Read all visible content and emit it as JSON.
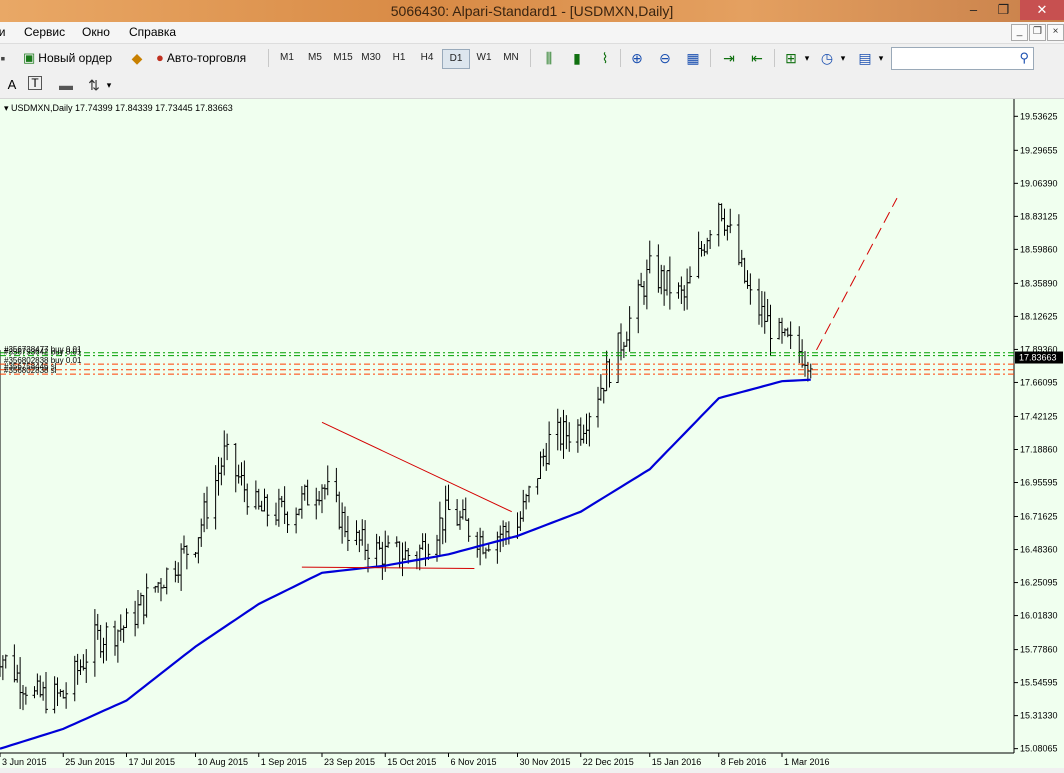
{
  "window": {
    "title": "5066430: Alpari-Standard1 - [USDMXN,Daily]",
    "minimize": "–",
    "restore": "❐",
    "close": "✕"
  },
  "menu": {
    "items": [
      "ии",
      "Сервис",
      "Окно",
      "Справка"
    ]
  },
  "toolbar": {
    "new_order": "Новый ордер",
    "auto_trading": "Авто-торговля",
    "timeframes": [
      "M1",
      "M5",
      "M15",
      "M30",
      "H1",
      "H4",
      "D1",
      "W1",
      "MN"
    ],
    "active_timeframe": "D1",
    "search_placeholder": ""
  },
  "colors": {
    "chart_bg": "#f0ffef",
    "candle": "#000000",
    "ma": "#0000d8",
    "trend": "#d40000",
    "buy_line": "#00a000",
    "sl_line": "#ff3c00",
    "price_tag_bg": "#000000"
  },
  "chart_data": {
    "type": "line",
    "symbol_header": "USDMXN,Daily  17.74399 17.84339 17.73445 17.83663",
    "symbol": "USDMXN",
    "timeframe": "Daily",
    "ohlc": [
      17.74399,
      17.84339,
      17.73445,
      17.83663
    ],
    "current_price": "17.83663",
    "y_ticks": [
      "19.53625",
      "19.29655",
      "19.06390",
      "18.83125",
      "18.59860",
      "18.35890",
      "18.12625",
      "17.89360",
      "17.66095",
      "17.42125",
      "17.18860",
      "16.95595",
      "16.71625",
      "16.48360",
      "16.25095",
      "16.01830",
      "15.77860",
      "15.54595",
      "15.31330",
      "15.08065"
    ],
    "x_ticks": [
      "3 Jun 2015",
      "25 Jun 2015",
      "17 Jul 2015",
      "10 Aug 2015",
      "1 Sep 2015",
      "23 Sep 2015",
      "15 Oct 2015",
      "6 Nov 2015",
      "30 Nov 2015",
      "22 Dec 2015",
      "15 Jan 2016",
      "8 Feb 2016",
      "1 Mar 2016"
    ],
    "ylim": [
      15.05,
      19.63
    ],
    "close_path": [
      [
        "3 Jun 2015",
        15.75
      ],
      [
        "15 Jun 2015",
        15.45
      ],
      [
        "25 Jun 2015",
        15.45
      ],
      [
        "6 Jul 2015",
        15.85
      ],
      [
        "17 Jul 2015",
        15.95
      ],
      [
        "28 Jul 2015",
        16.25
      ],
      [
        "10 Aug 2015",
        16.55
      ],
      [
        "20 Aug 2015",
        17.15
      ],
      [
        "1 Sep 2015",
        16.75
      ],
      [
        "12 Sep 2015",
        16.75
      ],
      [
        "23 Sep 2015",
        16.95
      ],
      [
        "4 Oct 2015",
        16.55
      ],
      [
        "15 Oct 2015",
        16.45
      ],
      [
        "26 Oct 2015",
        16.45
      ],
      [
        "6 Nov 2015",
        16.75
      ],
      [
        "18 Nov 2015",
        16.55
      ],
      [
        "30 Nov 2015",
        16.65
      ],
      [
        "11 Dec 2015",
        17.25
      ],
      [
        "22 Dec 2015",
        17.35
      ],
      [
        "3 Jan 2016",
        17.85
      ],
      [
        "15 Jan 2016",
        18.45
      ],
      [
        "27 Jan 2016",
        18.25
      ],
      [
        "8 Feb 2016",
        18.95
      ],
      [
        "19 Feb 2016",
        18.25
      ],
      [
        "1 Mar 2016",
        17.95
      ],
      [
        "11 Mar 2016",
        17.84
      ]
    ],
    "ma_path": [
      [
        "3 Jun 2015",
        15.08
      ],
      [
        "25 Jun 2015",
        15.22
      ],
      [
        "17 Jul 2015",
        15.42
      ],
      [
        "10 Aug 2015",
        15.8
      ],
      [
        "1 Sep 2015",
        16.1
      ],
      [
        "23 Sep 2015",
        16.32
      ],
      [
        "15 Oct 2015",
        16.37
      ],
      [
        "6 Nov 2015",
        16.45
      ],
      [
        "30 Nov 2015",
        16.58
      ],
      [
        "22 Dec 2015",
        16.75
      ],
      [
        "15 Jan 2016",
        17.05
      ],
      [
        "8 Feb 2016",
        17.55
      ],
      [
        "1 Mar 2016",
        17.67
      ],
      [
        "11 Mar 2016",
        17.68
      ]
    ],
    "trendlines": [
      {
        "x1": "23 Sep 2015",
        "y1": 17.38,
        "x2": "28 Nov 2015",
        "y2": 16.75
      },
      {
        "x1": "16 Sep 2015",
        "y1": 16.36,
        "x2": "15 Nov 2015",
        "y2": 16.35
      },
      {
        "x1": "13 Mar 2016",
        "y1": 17.89,
        "x2": "10 Apr 2016",
        "y2": 18.96,
        "dashed": true
      }
    ],
    "orders": [
      {
        "label": "#356738477 buy 0.01",
        "price": 17.87,
        "kind": "buy"
      },
      {
        "label": "#356793642 buy 0.01",
        "price": 17.85,
        "kind": "buy"
      },
      {
        "label": "#356802838 buy 0.01",
        "price": 17.79,
        "kind": "sl"
      },
      {
        "label": "#356758446 sl",
        "price": 17.75,
        "kind": "sl"
      },
      {
        "label": "#356802838 sl",
        "price": 17.72,
        "kind": "sl"
      }
    ]
  }
}
